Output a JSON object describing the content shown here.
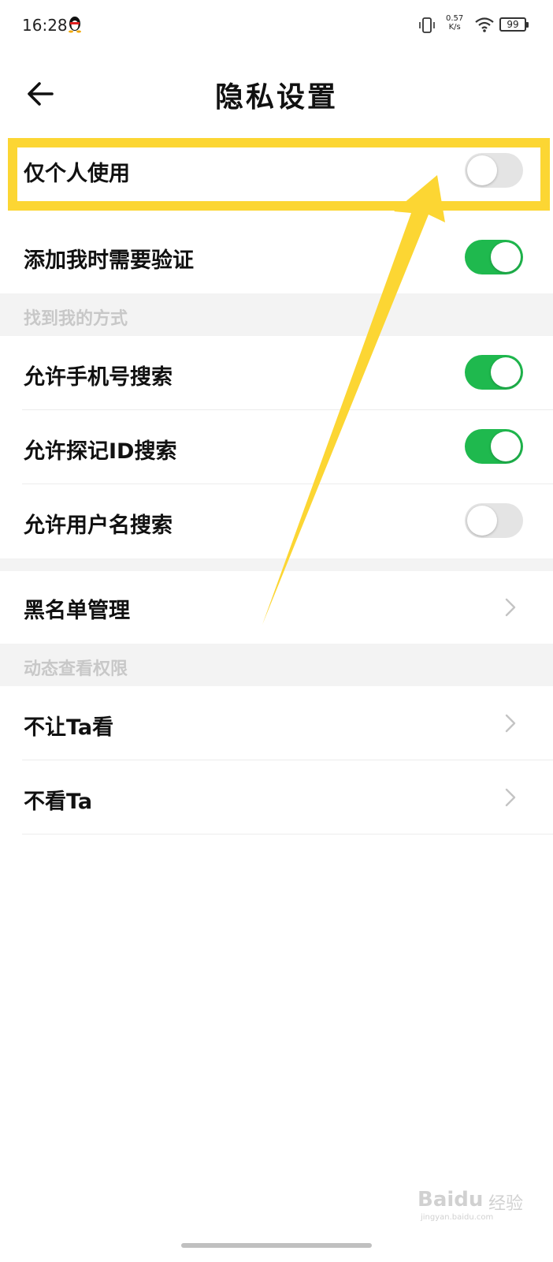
{
  "status_bar": {
    "time": "16:28",
    "network_speed_value": "0.57",
    "network_speed_unit": "K/s",
    "battery_level": "99"
  },
  "header": {
    "title": "隐私设置",
    "back_icon": "arrow-left-icon"
  },
  "settings": {
    "personal_only": {
      "label": "仅个人使用",
      "enabled": false
    },
    "verify_on_add": {
      "label": "添加我时需要验证",
      "enabled": true
    }
  },
  "find_me": {
    "section_title": "找到我的方式",
    "items": [
      {
        "label": "允许手机号搜索",
        "enabled": true
      },
      {
        "label": "允许探记ID搜索",
        "enabled": true
      },
      {
        "label": "允许用户名搜索",
        "enabled": false
      }
    ]
  },
  "blacklist": {
    "label": "黑名单管理"
  },
  "moments": {
    "section_title": "动态查看权限",
    "items": [
      {
        "label": "不让Ta看"
      },
      {
        "label": "不看Ta"
      }
    ]
  },
  "annotation": {
    "highlight_color": "#fcd633"
  },
  "watermark": {
    "brand": "Bai",
    "brand_suffix": "du",
    "cn": "经验",
    "site": "jingyan.baidu.com"
  },
  "colors": {
    "toggle_on": "#1fb94e",
    "toggle_off": "#e4e4e4",
    "section_bg": "#f3f3f3"
  }
}
